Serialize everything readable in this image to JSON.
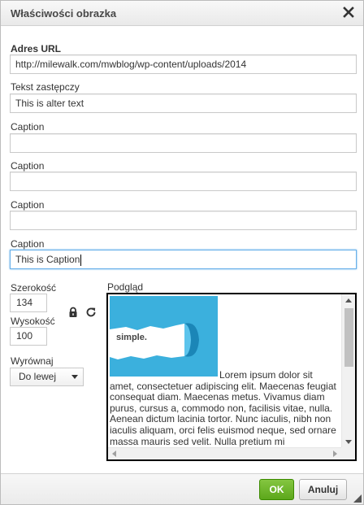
{
  "dialog": {
    "title": "Właściwości obrazka",
    "close_icon": "close-icon"
  },
  "fields": {
    "url_label": "Adres URL",
    "url_value": "http://milewalk.com/mwblog/wp-content/uploads/2014",
    "alt_label": "Tekst zastępczy",
    "alt_value": "This is alter text",
    "caption1_label": "Caption",
    "caption1_value": "",
    "caption2_label": "Caption",
    "caption2_value": "",
    "caption3_label": "Caption",
    "caption3_value": "",
    "caption4_label": "Caption",
    "caption4_value": "This is Caption"
  },
  "dimensions": {
    "width_label": "Szerokość",
    "width_value": "134",
    "height_label": "Wysokość",
    "height_value": "100",
    "lock_icon": "lock-icon",
    "reset_icon": "reset-icon"
  },
  "align": {
    "label": "Wyrównaj",
    "selected": "Do lewej"
  },
  "preview": {
    "label": "Podgląd",
    "image_text": "simple.",
    "lorem": "Lorem ipsum dolor sit amet, consectetuer adipiscing elit. Maecenas feugiat consequat diam. Maecenas metus. Vivamus diam purus, cursus a, commodo non, facilisis vitae, nulla. Aenean dictum lacinia tortor. Nunc iaculis, nibh non iaculis aliquam, orci felis euismod neque, sed ornare massa mauris sed velit. Nulla pretium mi"
  },
  "footer": {
    "ok_label": "OK",
    "cancel_label": "Anuluj"
  },
  "colors": {
    "ok_button": "#6cb52a",
    "focus_border": "#66afe9",
    "preview_image_bg": "#3bb0dd"
  }
}
